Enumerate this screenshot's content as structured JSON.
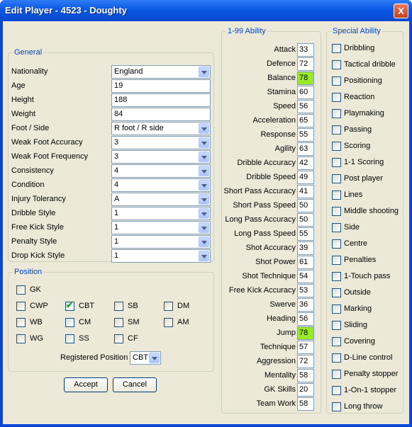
{
  "window": {
    "title": "Edit Player - 4523 - Doughty",
    "close_label": "X"
  },
  "general": {
    "legend": "General",
    "rows": [
      {
        "label": "Nationality",
        "value": "England",
        "type": "dropdown"
      },
      {
        "label": "Age",
        "value": "19",
        "type": "text"
      },
      {
        "label": "Height",
        "value": "188",
        "type": "text"
      },
      {
        "label": "Weight",
        "value": "84",
        "type": "text"
      },
      {
        "label": "Foot / Side",
        "value": "R foot / R side",
        "type": "dropdown"
      },
      {
        "label": "Weak Foot Accuracy",
        "value": "3",
        "type": "dropdown"
      },
      {
        "label": "Weak Foot Frequency",
        "value": "3",
        "type": "dropdown"
      },
      {
        "label": "Consistency",
        "value": "4",
        "type": "dropdown"
      },
      {
        "label": "Condition",
        "value": "4",
        "type": "dropdown"
      },
      {
        "label": "Injury Tolerancy",
        "value": "A",
        "type": "dropdown"
      },
      {
        "label": "Dribble Style",
        "value": "1",
        "type": "dropdown"
      },
      {
        "label": "Free Kick Style",
        "value": "1",
        "type": "dropdown"
      },
      {
        "label": "Penalty Style",
        "value": "1",
        "type": "dropdown"
      },
      {
        "label": "Drop Kick Style",
        "value": "1",
        "type": "dropdown"
      }
    ]
  },
  "position": {
    "legend": "Position",
    "checks": [
      {
        "label": "GK",
        "checked": false
      },
      {
        "label": "CWP",
        "checked": false
      },
      {
        "label": "CBT",
        "checked": true
      },
      {
        "label": "SB",
        "checked": false
      },
      {
        "label": "DM",
        "checked": false
      },
      {
        "label": "WB",
        "checked": false
      },
      {
        "label": "CM",
        "checked": false
      },
      {
        "label": "SM",
        "checked": false
      },
      {
        "label": "AM",
        "checked": false
      },
      {
        "label": "WG",
        "checked": false
      },
      {
        "label": "SS",
        "checked": false
      },
      {
        "label": "CF",
        "checked": false
      }
    ],
    "registered_label": "Registered Position",
    "registered_value": "CBT"
  },
  "buttons": {
    "accept": "Accept",
    "cancel": "Cancel"
  },
  "ability": {
    "legend": "1-99 Ability",
    "highlight_color": "#9aea2a",
    "rows": [
      {
        "label": "Attack",
        "value": "33",
        "highlight": false
      },
      {
        "label": "Defence",
        "value": "72",
        "highlight": false
      },
      {
        "label": "Balance",
        "value": "78",
        "highlight": true
      },
      {
        "label": "Stamina",
        "value": "60",
        "highlight": false
      },
      {
        "label": "Speed",
        "value": "56",
        "highlight": false
      },
      {
        "label": "Acceleration",
        "value": "65",
        "highlight": false
      },
      {
        "label": "Response",
        "value": "55",
        "highlight": false
      },
      {
        "label": "Agility",
        "value": "63",
        "highlight": false
      },
      {
        "label": "Dribble Accuracy",
        "value": "42",
        "highlight": false
      },
      {
        "label": "Dribble Speed",
        "value": "49",
        "highlight": false
      },
      {
        "label": "Short Pass Accuracy",
        "value": "41",
        "highlight": false
      },
      {
        "label": "Short Pass Speed",
        "value": "50",
        "highlight": false
      },
      {
        "label": "Long Pass Accuracy",
        "value": "50",
        "highlight": false
      },
      {
        "label": "Long Pass Speed",
        "value": "55",
        "highlight": false
      },
      {
        "label": "Shot Accuracy",
        "value": "39",
        "highlight": false
      },
      {
        "label": "Shot Power",
        "value": "61",
        "highlight": false
      },
      {
        "label": "Shot Technique",
        "value": "54",
        "highlight": false
      },
      {
        "label": "Free Kick Accuracy",
        "value": "53",
        "highlight": false
      },
      {
        "label": "Swerve",
        "value": "36",
        "highlight": false
      },
      {
        "label": "Heading",
        "value": "56",
        "highlight": false
      },
      {
        "label": "Jump",
        "value": "78",
        "highlight": true
      },
      {
        "label": "Technique",
        "value": "57",
        "highlight": false
      },
      {
        "label": "Aggression",
        "value": "72",
        "highlight": false
      },
      {
        "label": "Mentality",
        "value": "58",
        "highlight": false
      },
      {
        "label": "GK Skills",
        "value": "20",
        "highlight": false
      },
      {
        "label": "Team Work",
        "value": "58",
        "highlight": false
      }
    ]
  },
  "special": {
    "legend": "Special Ability",
    "items": [
      {
        "label": "Dribbling",
        "checked": false
      },
      {
        "label": "Tactical dribble",
        "checked": false
      },
      {
        "label": "Positioning",
        "checked": false
      },
      {
        "label": "Reaction",
        "checked": false
      },
      {
        "label": "Playmaking",
        "checked": false
      },
      {
        "label": "Passing",
        "checked": false
      },
      {
        "label": "Scoring",
        "checked": false
      },
      {
        "label": "1-1 Scoring",
        "checked": false
      },
      {
        "label": "Post player",
        "checked": false
      },
      {
        "label": "Lines",
        "checked": false
      },
      {
        "label": "Middle shooting",
        "checked": false
      },
      {
        "label": "Side",
        "checked": false
      },
      {
        "label": "Centre",
        "checked": false
      },
      {
        "label": "Penalties",
        "checked": false
      },
      {
        "label": "1-Touch pass",
        "checked": false
      },
      {
        "label": "Outside",
        "checked": false
      },
      {
        "label": "Marking",
        "checked": false
      },
      {
        "label": "Sliding",
        "checked": false
      },
      {
        "label": "Covering",
        "checked": false
      },
      {
        "label": "D-Line control",
        "checked": false
      },
      {
        "label": "Penalty stopper",
        "checked": false
      },
      {
        "label": "1-On-1 stopper",
        "checked": false
      },
      {
        "label": "Long throw",
        "checked": false
      }
    ]
  }
}
